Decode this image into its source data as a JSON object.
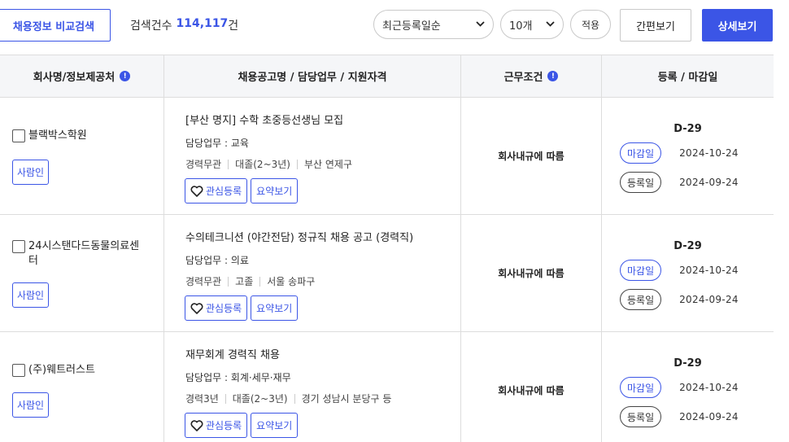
{
  "toolbar": {
    "compare_label": "채용정보 비교검색",
    "count_label": "검색건수",
    "count_value": "114,117",
    "count_unit": "건",
    "sort_value": "최근등록일순",
    "per_page_value": "10개",
    "apply_label": "적용",
    "simple_view_label": "간편보기",
    "detail_view_label": "상세보기"
  },
  "columns": {
    "company": "회사명/정보제공처",
    "job": "채용공고명 / 담당업무 / 지원자격",
    "condition": "근무조건",
    "dates": "등록 / 마감일"
  },
  "rows": [
    {
      "company": "블랙박스학원",
      "source_label": "사람인",
      "title": "[부산 명지] 수학 초중등선생님 모집",
      "duty": "담당업무 : 교육",
      "quals": [
        "경력무관",
        "대졸(2~3년)",
        "부산 연제구"
      ],
      "interest_label": "관심등록",
      "summary_label": "요약보기",
      "condition": "회사내규에 따름",
      "dday": "D-29",
      "deadline_label": "마감일",
      "deadline_date": "2024-10-24",
      "reg_label": "등록일",
      "reg_date": "2024-09-24"
    },
    {
      "company": "24시스탠다드동물의료센터",
      "source_label": "사람인",
      "title": "수의테크니션 (야간전담) 정규직 채용 공고 (경력직)",
      "duty": "담당업무 : 의료",
      "quals": [
        "경력무관",
        "고졸",
        "서울 송파구"
      ],
      "interest_label": "관심등록",
      "summary_label": "요약보기",
      "condition": "회사내규에 따름",
      "dday": "D-29",
      "deadline_label": "마감일",
      "deadline_date": "2024-10-24",
      "reg_label": "등록일",
      "reg_date": "2024-09-24"
    },
    {
      "company": "(주)웨트러스트",
      "source_label": "사람인",
      "title": "재무회계 경력직 채용",
      "duty": "담당업무 : 회계·세무·재무",
      "quals": [
        "경력3년",
        "대졸(2~3년)",
        "경기 성남시 분당구 등"
      ],
      "interest_label": "관심등록",
      "summary_label": "요약보기",
      "condition": "회사내규에 따름",
      "dday": "D-29",
      "deadline_label": "마감일",
      "deadline_date": "2024-10-24",
      "reg_label": "등록일",
      "reg_date": "2024-09-24"
    }
  ],
  "colors": {
    "accent": "#3b55e6",
    "border": "#dddddd",
    "header_bg": "#f5f6f8"
  }
}
